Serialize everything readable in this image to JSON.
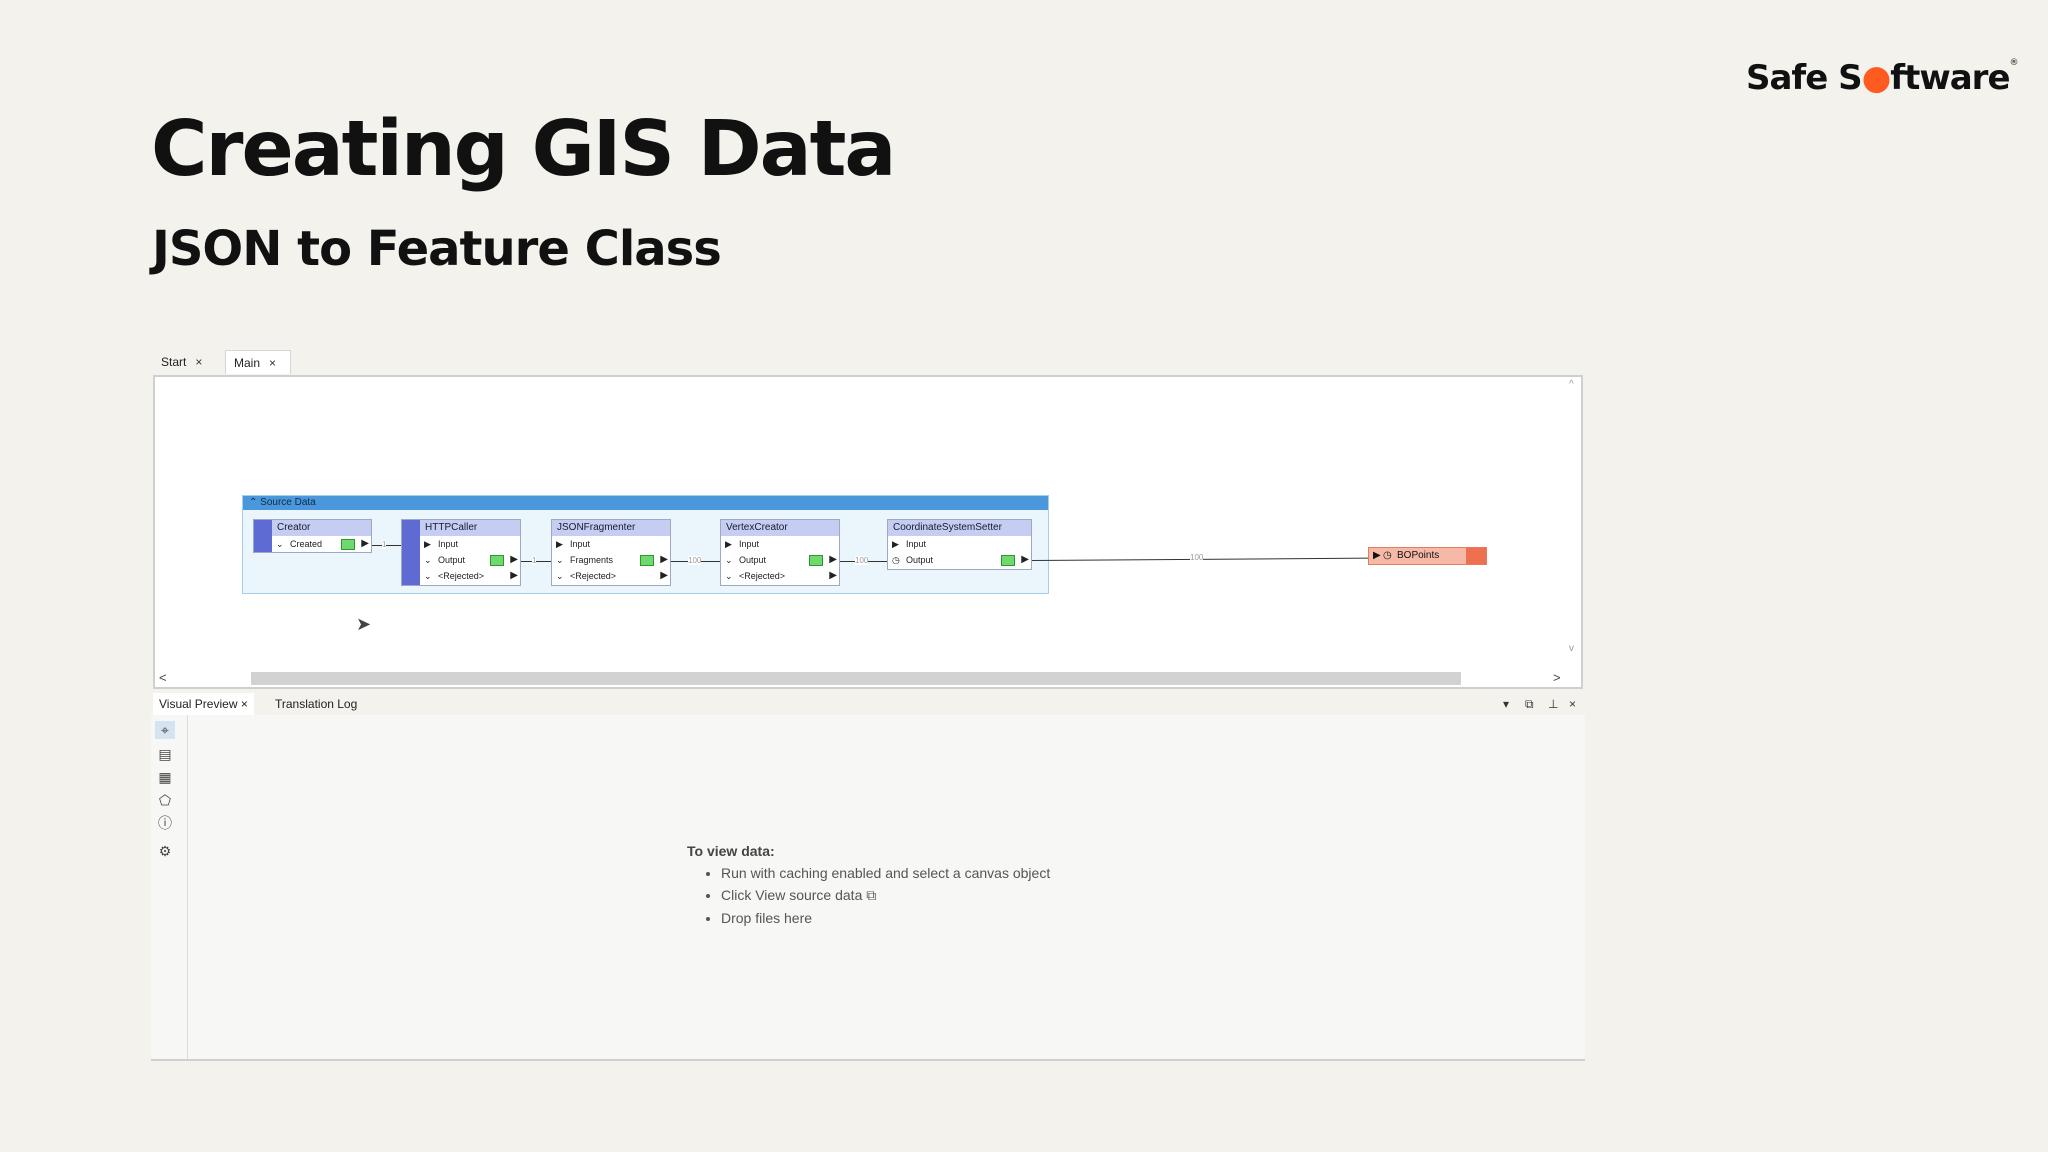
{
  "brand": {
    "part1": "Safe S",
    "dot": "●",
    "part2": "ftware",
    "tm": "®"
  },
  "slide": {
    "title": "Creating GIS Data",
    "subtitle": "JSON to Feature Class"
  },
  "workspace_tabs": [
    {
      "label": "Start",
      "close": "×"
    },
    {
      "label": "Main",
      "close": "×"
    }
  ],
  "canvas": {
    "bookmark": {
      "title": "⌃ Source Data"
    },
    "nodes": {
      "creator": {
        "title": "Creator",
        "ports": [
          "Created"
        ]
      },
      "httpcaller": {
        "title": "HTTPCaller",
        "ports": [
          "Input",
          "Output",
          "<Rejected>"
        ]
      },
      "jsonfragmenter": {
        "title": "JSONFragmenter",
        "ports": [
          "Input",
          "Fragments",
          "<Rejected>"
        ]
      },
      "vertexcreator": {
        "title": "VertexCreator",
        "ports": [
          "Input",
          "Output",
          "<Rejected>"
        ]
      },
      "coordsetter": {
        "title": "CoordinateSystemSetter",
        "ports": [
          "Input",
          "Output"
        ]
      }
    },
    "link_counts": {
      "c1": "1",
      "c2": "1",
      "c3": "100",
      "c4": "100",
      "c5": "100"
    },
    "writer": {
      "label": "BOPoints"
    },
    "scroll": {
      "left": "<",
      "right": ">",
      "up": "^",
      "down": "v"
    }
  },
  "bottom_tabs": [
    {
      "label": "Visual Preview",
      "close": "×"
    },
    {
      "label": "Translation Log"
    }
  ],
  "window_controls": {
    "dropdown": "▾",
    "float": "⧉",
    "pin": "⊥",
    "close": "×"
  },
  "preview": {
    "heading": "To view data:",
    "items": [
      "Run with caching enabled and select a canvas object",
      "Click View source data",
      "Drop files here"
    ],
    "view_source_icon": "⧉"
  },
  "icons": {
    "cursor": "cursor-arrow-icon"
  }
}
